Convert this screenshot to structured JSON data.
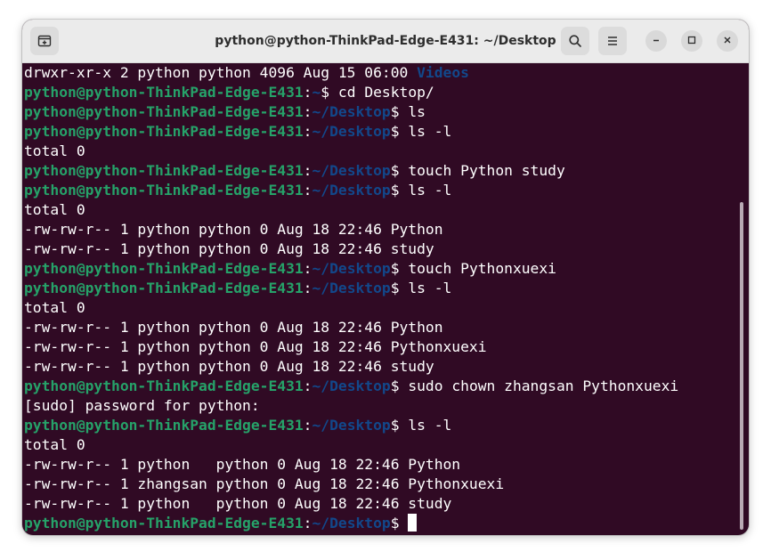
{
  "window": {
    "title": "python@python-ThinkPad-Edge-E431: ~/Desktop"
  },
  "icons": {
    "new_tab": "new-tab-icon",
    "search": "search-icon",
    "menu": "hamburger-menu-icon",
    "minimize": "minimize-icon",
    "maximize": "maximize-icon",
    "close": "close-icon"
  },
  "colors": {
    "terminal_bg": "#300a24",
    "user_host": "#26a269",
    "path": "#12488b",
    "text": "#ffffff"
  },
  "terminal": {
    "lines": [
      {
        "type": "dirout",
        "text": "drwxr-xr-x 2 python python 4096 Aug 15 06:00 ",
        "name": "Videos"
      },
      {
        "type": "prompt",
        "user": "python@python-ThinkPad-Edge-E431",
        "sep": ":",
        "path": "~",
        "sym": "$ ",
        "cmd": "cd Desktop/"
      },
      {
        "type": "prompt",
        "user": "python@python-ThinkPad-Edge-E431",
        "sep": ":",
        "path": "~/Desktop",
        "sym": "$ ",
        "cmd": "ls"
      },
      {
        "type": "prompt",
        "user": "python@python-ThinkPad-Edge-E431",
        "sep": ":",
        "path": "~/Desktop",
        "sym": "$ ",
        "cmd": "ls -l"
      },
      {
        "type": "out",
        "text": "total 0"
      },
      {
        "type": "prompt",
        "user": "python@python-ThinkPad-Edge-E431",
        "sep": ":",
        "path": "~/Desktop",
        "sym": "$ ",
        "cmd": "touch Python study"
      },
      {
        "type": "prompt",
        "user": "python@python-ThinkPad-Edge-E431",
        "sep": ":",
        "path": "~/Desktop",
        "sym": "$ ",
        "cmd": "ls -l"
      },
      {
        "type": "out",
        "text": "total 0"
      },
      {
        "type": "out",
        "text": "-rw-rw-r-- 1 python python 0 Aug 18 22:46 Python"
      },
      {
        "type": "out",
        "text": "-rw-rw-r-- 1 python python 0 Aug 18 22:46 study"
      },
      {
        "type": "prompt",
        "user": "python@python-ThinkPad-Edge-E431",
        "sep": ":",
        "path": "~/Desktop",
        "sym": "$ ",
        "cmd": "touch Pythonxuexi"
      },
      {
        "type": "prompt",
        "user": "python@python-ThinkPad-Edge-E431",
        "sep": ":",
        "path": "~/Desktop",
        "sym": "$ ",
        "cmd": "ls -l"
      },
      {
        "type": "out",
        "text": "total 0"
      },
      {
        "type": "out",
        "text": "-rw-rw-r-- 1 python python 0 Aug 18 22:46 Python"
      },
      {
        "type": "out",
        "text": "-rw-rw-r-- 1 python python 0 Aug 18 22:46 Pythonxuexi"
      },
      {
        "type": "out",
        "text": "-rw-rw-r-- 1 python python 0 Aug 18 22:46 study"
      },
      {
        "type": "prompt",
        "user": "python@python-ThinkPad-Edge-E431",
        "sep": ":",
        "path": "~/Desktop",
        "sym": "$ ",
        "cmd": "sudo chown zhangsan Pythonxuexi"
      },
      {
        "type": "out",
        "text": "[sudo] password for python:"
      },
      {
        "type": "prompt",
        "user": "python@python-ThinkPad-Edge-E431",
        "sep": ":",
        "path": "~/Desktop",
        "sym": "$ ",
        "cmd": "ls -l"
      },
      {
        "type": "out",
        "text": "total 0"
      },
      {
        "type": "out",
        "text": "-rw-rw-r-- 1 python   python 0 Aug 18 22:46 Python"
      },
      {
        "type": "out",
        "text": "-rw-rw-r-- 1 zhangsan python 0 Aug 18 22:46 Pythonxuexi"
      },
      {
        "type": "out",
        "text": "-rw-rw-r-- 1 python   python 0 Aug 18 22:46 study"
      },
      {
        "type": "prompt",
        "user": "python@python-ThinkPad-Edge-E431",
        "sep": ":",
        "path": "~/Desktop",
        "sym": "$ ",
        "cmd": "",
        "cursor": true
      }
    ]
  }
}
